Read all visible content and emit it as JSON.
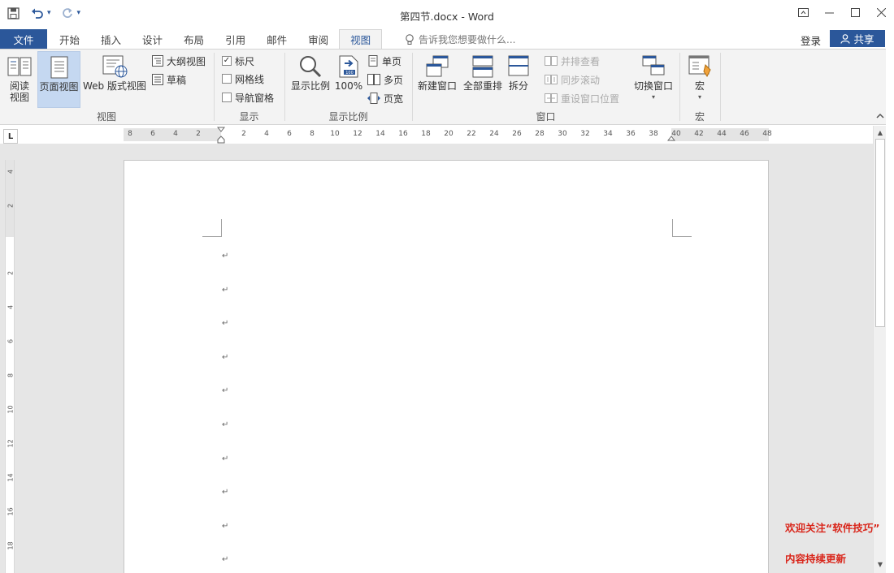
{
  "window": {
    "title": "第四节.docx - Word",
    "controls": [
      "ribbon-display-icon",
      "minimize-icon",
      "maximize-icon",
      "close-icon"
    ]
  },
  "qat": {
    "customize_glyph": "▾"
  },
  "tabs": {
    "file": "文件",
    "items": [
      "开始",
      "插入",
      "设计",
      "布局",
      "引用",
      "邮件",
      "审阅",
      "视图"
    ],
    "active": "视图"
  },
  "tellme": {
    "placeholder": "告诉我您想要做什么..."
  },
  "account": {
    "signin": "登录",
    "share": "共享"
  },
  "ribbon": {
    "views": {
      "label": "视图",
      "read_mode": [
        "阅读",
        "视图"
      ],
      "print_layout": "页面视图",
      "web_layout": "Web 版式视图",
      "outline": "大纲视图",
      "draft": "草稿"
    },
    "show": {
      "label": "显示",
      "ruler": "标尺",
      "ruler_checked": true,
      "gridlines": "网格线",
      "gridlines_checked": false,
      "nav_pane": "导航窗格",
      "nav_pane_checked": false
    },
    "zoom": {
      "label": "显示比例",
      "zoom": "显示比例",
      "hundred": "100%",
      "one_page": "单页",
      "multi_page": "多页",
      "page_width": "页宽"
    },
    "window": {
      "label": "窗口",
      "new_window": "新建窗口",
      "arrange_all": "全部重排",
      "split": "拆分",
      "side_by_side": "并排查看",
      "sync_scroll": "同步滚动",
      "reset_position": "重设窗口位置",
      "switch_windows": "切换窗口"
    },
    "macros": {
      "label": "宏",
      "macros": "宏"
    }
  },
  "ruler": {
    "h_left": [
      "8",
      "6",
      "4",
      "2"
    ],
    "h_right": [
      "2",
      "4",
      "6",
      "8",
      "10",
      "12",
      "14",
      "16",
      "18",
      "20",
      "22",
      "24",
      "26",
      "28",
      "30",
      "32",
      "34",
      "36",
      "38",
      "40",
      "42",
      "44",
      "46",
      "48"
    ],
    "v_top": [
      "4",
      "2"
    ],
    "v_body": [
      "2",
      "4",
      "6",
      "8",
      "10",
      "12",
      "14",
      "16",
      "18"
    ],
    "tab_selector": "L"
  },
  "document": {
    "paragraph_mark": "↵",
    "paragraph_count": 10
  },
  "watermark": {
    "line1": "欢迎关注“软件技巧”",
    "line2": "内容持续更新"
  },
  "colors": {
    "accent": "#2b579a",
    "watermark": "#d9251a",
    "selected": "#c5d8f1"
  }
}
